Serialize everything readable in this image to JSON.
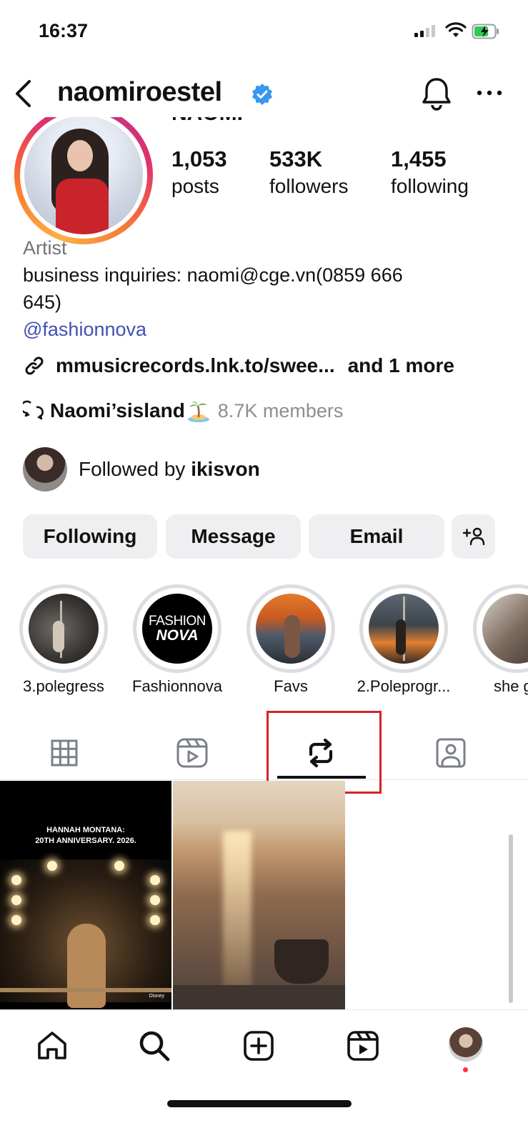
{
  "status_bar": {
    "time": "16:37"
  },
  "header": {
    "username": "naomiroestel"
  },
  "profile": {
    "full_name": "NAOMI",
    "stats": [
      {
        "value": "1,053",
        "label": "posts"
      },
      {
        "value": "533K",
        "label": "followers"
      },
      {
        "value": "1,455",
        "label": "following"
      }
    ],
    "bio": {
      "category": "Artist",
      "line1": "business inquiries: naomi@cge.vn(0859 666",
      "line2": "645)",
      "mention": "@fashionnova"
    },
    "link": {
      "text": "mmusicrecords.lnk.to/swee...",
      "more": "and 1 more"
    },
    "channel": {
      "name": "Naomi’sisland",
      "members": "8.7K members"
    },
    "followed_by": {
      "prefix": "Followed by ",
      "user": "ikisvon"
    }
  },
  "buttons": {
    "following": "Following",
    "message": "Message",
    "email": "Email"
  },
  "highlights": [
    {
      "label": "3.polegress"
    },
    {
      "label": "Fashionnova",
      "logo_line1": "FASHION",
      "logo_line2": "NOVA"
    },
    {
      "label": "Favs"
    },
    {
      "label": "2.Poleprogr..."
    },
    {
      "label": "she go"
    }
  ],
  "tabs": {
    "active": "reposts",
    "items": [
      "posts-grid",
      "reels",
      "reposts",
      "tagged"
    ]
  },
  "grid": {
    "post1_title_line1": "HANNAH MONTANA:",
    "post1_title_line2": "20TH ANNIVERSARY. 2026.",
    "post1_watermark": "Disney"
  },
  "bottom_nav": {
    "items": [
      "home-icon",
      "search-icon",
      "create-icon",
      "reels-icon",
      "profile-avatar"
    ]
  },
  "colors": {
    "verified": "#3897f0",
    "mention": "#3f51b5",
    "highlight_box": "#d2222a",
    "notification_dot": "#ff3040"
  }
}
